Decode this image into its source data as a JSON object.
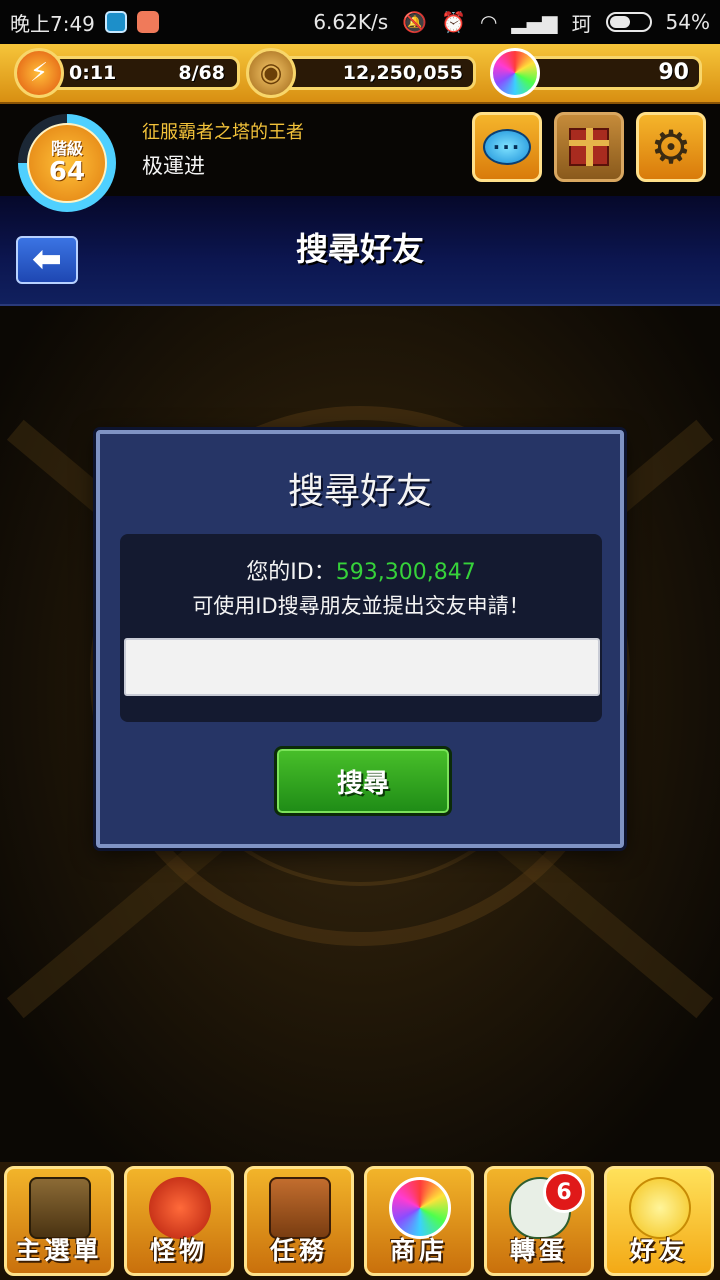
{
  "status_bar": {
    "time": "晚上7:49",
    "network_speed": "6.62K/s",
    "carrier": "珂",
    "battery": "54%",
    "battery_level": 0.54,
    "icons": [
      "app-notification-icon",
      "app-notification-icon",
      "alarm-off-icon",
      "alarm-icon",
      "wifi-icon",
      "signal-icon",
      "battery-icon"
    ]
  },
  "resources": {
    "stamina_timer": "0:11",
    "stamina": "8/68",
    "gold": "12,250,055",
    "orbs": "90",
    "icons": [
      "stamina-lightning-icon",
      "gold-coin-icon",
      "rainbow-orb-icon"
    ]
  },
  "profile": {
    "rank_label": "階級",
    "rank_value": "64",
    "rank_progress": 0.75,
    "title": "征服霸者之塔的王者",
    "name": "极運进",
    "buttons": [
      "chat-button",
      "gift-button",
      "settings-button"
    ]
  },
  "header": {
    "title": "搜尋好友",
    "back_icon": "back-arrow-icon"
  },
  "dialog": {
    "title": "搜尋好友",
    "id_label": "您的ID：",
    "id_value": "593,300,847",
    "hint": "可使用ID搜尋朋友並提出交友申請！",
    "input_value": "",
    "input_placeholder": "",
    "search_label": "搜尋"
  },
  "bottom_nav": [
    {
      "label": "主選單",
      "icon": "home-gate-icon"
    },
    {
      "label": "怪物",
      "icon": "monster-icon"
    },
    {
      "label": "任務",
      "icon": "quest-book-icon"
    },
    {
      "label": "商店",
      "icon": "shop-orb-icon"
    },
    {
      "label": "轉蛋",
      "icon": "gacha-egg-icon",
      "badge": "6"
    },
    {
      "label": "好友",
      "icon": "friends-icon",
      "active": true
    }
  ],
  "colors": {
    "gold_frame": "#f6c53a",
    "header_navy": "#0c1650",
    "dialog_bg": "#263566",
    "id_green": "#36d23a",
    "button_green": "#1e8b16",
    "badge_red": "#e01919"
  }
}
